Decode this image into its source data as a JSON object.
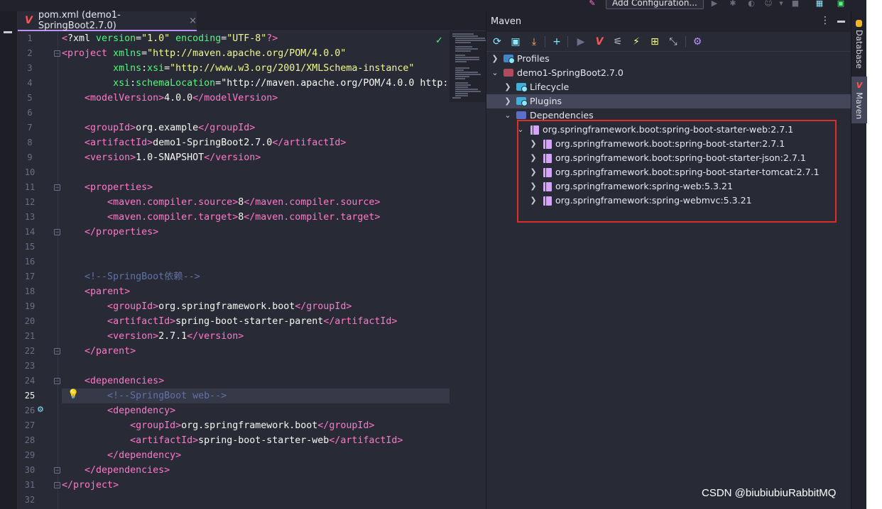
{
  "toolbar": {
    "add_configuration_label": "Add Configuration..."
  },
  "editor_tab": {
    "title": "pom.xml (demo1-SpringBoot2.7.0)",
    "close_glyph": "×"
  },
  "editor": {
    "current_line": 25,
    "line_numbers": [
      "1",
      "2",
      "3",
      "4",
      "5",
      "6",
      "7",
      "8",
      "9",
      "10",
      "11",
      "12",
      "13",
      "14",
      "15",
      "16",
      "17",
      "18",
      "19",
      "20",
      "21",
      "22",
      "23",
      "24",
      "25",
      "26",
      "27",
      "28",
      "29",
      "30",
      "31",
      "32"
    ],
    "lines": [
      "<?xml version=\"1.0\" encoding=\"UTF-8\"?>",
      "<project xmlns=\"http://maven.apache.org/POM/4.0.0\"",
      "         xmlns:xsi=\"http://www.w3.org/2001/XMLSchema-instance\"",
      "         xsi:schemaLocation=\"http://maven.apache.org/POM/4.0.0 http:",
      "    <modelVersion>4.0.0</modelVersion>",
      "",
      "    <groupId>org.example</groupId>",
      "    <artifactId>demo1-SpringBoot2.7.0</artifactId>",
      "    <version>1.0-SNAPSHOT</version>",
      "",
      "    <properties>",
      "        <maven.compiler.source>8</maven.compiler.source>",
      "        <maven.compiler.target>8</maven.compiler.target>",
      "    </properties>",
      "",
      "",
      "    <!--SpringBoot依赖-->",
      "    <parent>",
      "        <groupId>org.springframework.boot</groupId>",
      "        <artifactId>spring-boot-starter-parent</artifactId>",
      "        <version>2.7.1</version>",
      "    </parent>",
      "",
      "    <dependencies>",
      "        <!--SpringBoot web-->",
      "        <dependency>",
      "            <groupId>org.springframework.boot</groupId>",
      "            <artifactId>spring-boot-starter-web</artifactId>",
      "        </dependency>",
      "    </dependencies>",
      "</project>",
      ""
    ]
  },
  "maven_panel": {
    "title": "Maven",
    "menu_glyph": "⋮",
    "tree": {
      "profiles": "Profiles",
      "project": "demo1-SpringBoot2.7.0",
      "lifecycle": "Lifecycle",
      "plugins": "Plugins",
      "dependencies": "Dependencies",
      "root_dependency": "org.springframework.boot:spring-boot-starter-web:2.7.1",
      "child_dependencies": [
        "org.springframework.boot:spring-boot-starter:2.7.1",
        "org.springframework.boot:spring-boot-starter-json:2.7.1",
        "org.springframework.boot:spring-boot-starter-tomcat:2.7.1",
        "org.springframework:spring-web:5.3.21",
        "org.springframework:spring-webmvc:5.3.21"
      ]
    }
  },
  "right_strip": {
    "database_tab": "Database",
    "maven_tab": "Maven"
  },
  "watermark": "CSDN @biubiubiuRabbitMQ",
  "colors": {
    "editor_bg": "#282a36",
    "tag": "#ff79c6",
    "attribute": "#50fa7b",
    "string": "#f1fa8c",
    "comment": "#6272a4",
    "selection": "#44475a",
    "highlight_box": "#e12b2b"
  }
}
